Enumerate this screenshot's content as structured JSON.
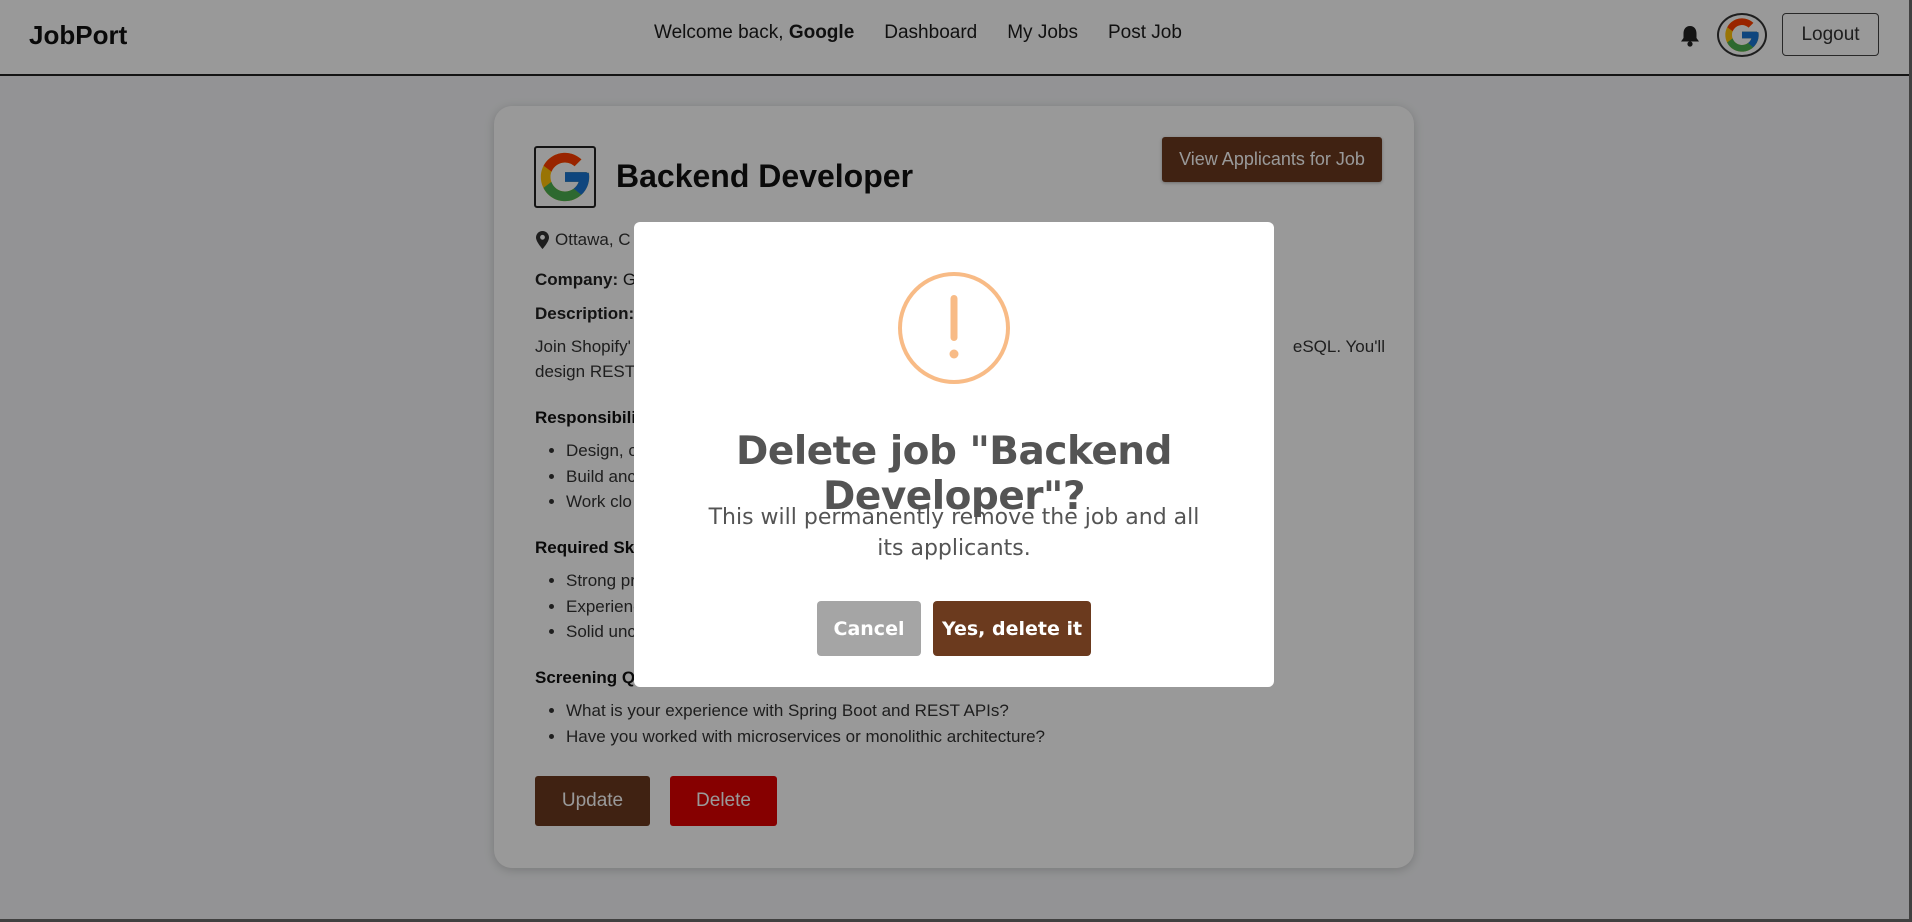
{
  "navbar": {
    "brand": "JobPort",
    "welcome_prefix": "Welcome back,",
    "welcome_user": "Google",
    "links": [
      "Dashboard",
      "My Jobs",
      "Post Job"
    ],
    "logout_label": "Logout"
  },
  "job": {
    "title": "Backend Developer",
    "view_applicants_label": "View Applicants for Job",
    "location": "Ottawa, C",
    "company_label": "Company:",
    "company_value": "G",
    "description_label": "Description:",
    "description_line1_start": "Join Shopify'",
    "description_line1_end": "eSQL. You'll",
    "description_line2_start": "design REST",
    "responsibilities_label": "Responsibili",
    "responsibilities": [
      "Design, c",
      "Build anc",
      "Work clo"
    ],
    "skills_label": "Required Sk",
    "skills": [
      "Strong pr",
      "Experienc",
      "Solid unc"
    ],
    "screening_label": "Screening Q",
    "screening_questions": [
      "What is your experience with Spring Boot and REST APIs?",
      "Have you worked with microservices or monolithic architecture?"
    ],
    "update_label": "Update",
    "delete_label": "Delete"
  },
  "modal": {
    "icon_glyph": "!",
    "title": "Delete job \"Backend Developer\"?",
    "text": "This will permanently remove the job and all its applicants.",
    "cancel_label": "Cancel",
    "confirm_label": "Yes, delete it"
  },
  "colors": {
    "primary_brown": "#6b3a1e",
    "danger_red": "#e00000",
    "warning_orange": "#f8bb86",
    "cancel_gray": "#a5a5a5"
  }
}
